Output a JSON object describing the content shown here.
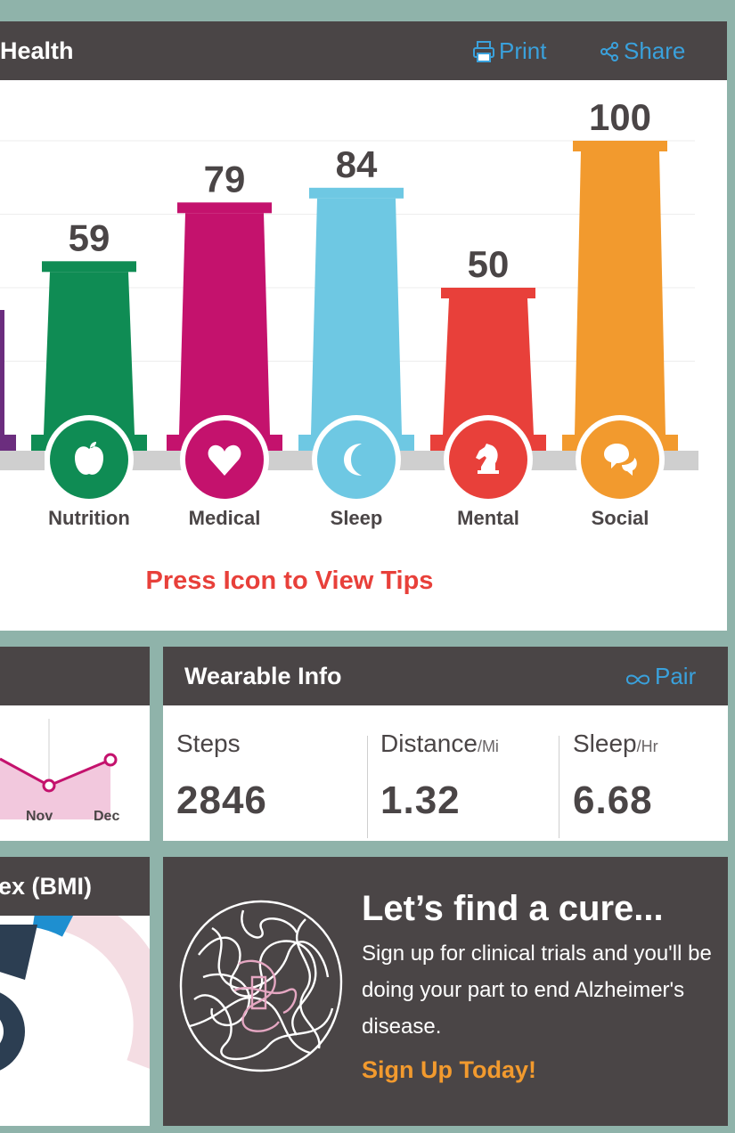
{
  "health": {
    "title": "Health",
    "print_label": "Print",
    "share_label": "Share",
    "tips_text": "Press Icon to View Tips"
  },
  "chart_data": {
    "type": "bar",
    "categories": [
      "Nutrition",
      "Medical",
      "Sleep",
      "Mental",
      "Social"
    ],
    "values": [
      59,
      79,
      84,
      50,
      100
    ],
    "colors": [
      "#0f8c54",
      "#c4126d",
      "#6ec8e3",
      "#e8403a",
      "#f29a2e"
    ],
    "icons": [
      "apple-icon",
      "heart-icon",
      "moon-icon",
      "chess-knight-icon",
      "chat-bubbles-icon"
    ],
    "ylim": [
      0,
      100
    ]
  },
  "trend": {
    "months": [
      "Nov",
      "Dec"
    ]
  },
  "wearable": {
    "title": "Wearable Info",
    "pair_label": "Pair",
    "metrics": [
      {
        "label": "Steps",
        "unit": "",
        "value": "2846"
      },
      {
        "label": "Distance",
        "unit": "/Mi",
        "value": "1.32"
      },
      {
        "label": "Sleep",
        "unit": "/Hr",
        "value": "6.68"
      }
    ]
  },
  "bmi": {
    "title": "ex (BMI)"
  },
  "cure": {
    "title": "Let’s find a cure...",
    "body": "Sign up for clinical trials and you'll be doing your part to end Alzheimer's disease.",
    "cta": "Sign Up Today!"
  }
}
